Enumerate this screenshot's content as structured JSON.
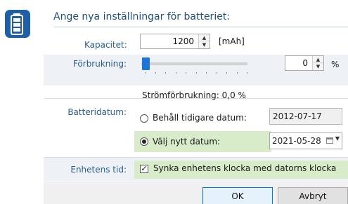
{
  "heading": "Ange nya inställningar för batteriet:",
  "capacity": {
    "label": "Kapacitet:",
    "value": "1200",
    "unit": "[mAh]"
  },
  "consumption": {
    "label": "Förbrukning:",
    "slider_value_percent": 0,
    "value": "0",
    "unit": "%",
    "summary": "Strömförbrukning: 0,0 %"
  },
  "battery_date": {
    "label": "Batteridatum:",
    "keep_option": "Behåll tidigare datum:",
    "keep_date": "2012-07-17",
    "new_option": "Välj nytt datum:",
    "new_date": "2021-05-28",
    "selected": "new"
  },
  "device_time": {
    "label": "Enhetens tid:",
    "sync_label": "Synka enhetens klocka med datorns klocka",
    "checked": true
  },
  "buttons": {
    "ok": "OK",
    "cancel": "Avbryt"
  },
  "colors": {
    "accent": "#1e73d6",
    "highlight": "#d8ecc9",
    "label_blue": "#2a5d8f"
  }
}
